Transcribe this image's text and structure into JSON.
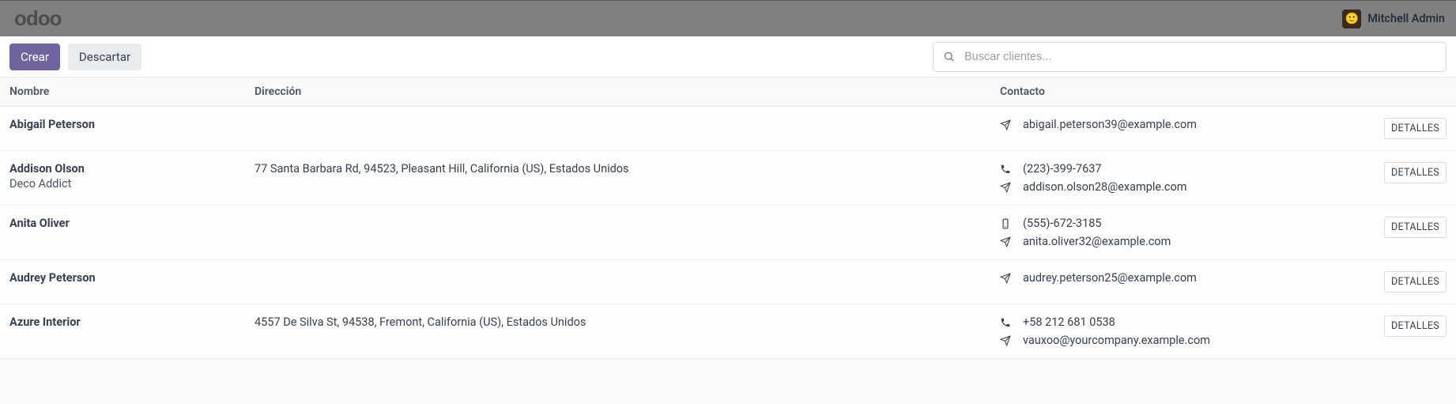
{
  "brand": "odoo",
  "user": {
    "name": "Mitchell Admin"
  },
  "toolbar": {
    "create": "Crear",
    "discard": "Descartar"
  },
  "search": {
    "placeholder": "Buscar clientes..."
  },
  "columns": {
    "name": "Nombre",
    "address": "Dirección",
    "contact": "Contacto"
  },
  "details_label": "DETALLES",
  "rows": [
    {
      "name": "Abigail Peterson",
      "subtitle": "",
      "address": "",
      "phone": "",
      "phone_icon": "",
      "email": "abigail.peterson39@example.com"
    },
    {
      "name": "Addison Olson",
      "subtitle": "Deco Addict",
      "address": "77 Santa Barbara Rd, 94523, Pleasant Hill, California (US), Estados Unidos",
      "phone": "(223)-399-7637",
      "phone_icon": "phone",
      "email": "addison.olson28@example.com"
    },
    {
      "name": "Anita Oliver",
      "subtitle": "",
      "address": "",
      "phone": "(555)-672-3185",
      "phone_icon": "mobile",
      "email": "anita.oliver32@example.com"
    },
    {
      "name": "Audrey Peterson",
      "subtitle": "",
      "address": "",
      "phone": "",
      "phone_icon": "",
      "email": "audrey.peterson25@example.com"
    },
    {
      "name": "Azure Interior",
      "subtitle": "",
      "address": "4557 De Silva St, 94538, Fremont, California (US), Estados Unidos",
      "phone": "+58 212 681 0538",
      "phone_icon": "phone",
      "email": "vauxoo@yourcompany.example.com"
    }
  ]
}
